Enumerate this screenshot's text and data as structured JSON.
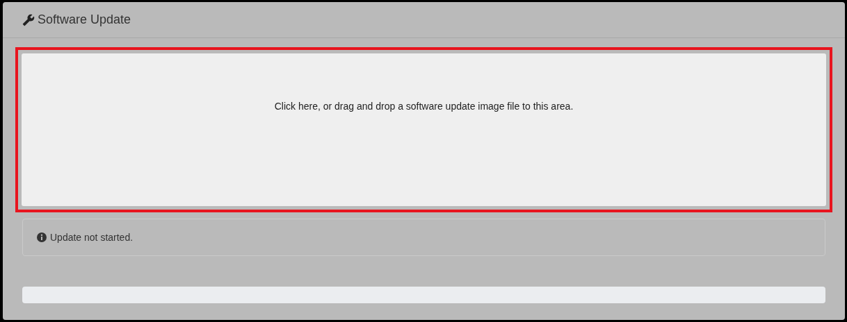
{
  "panel": {
    "title": "Software Update"
  },
  "dropzone": {
    "text": "Click here, or drag and drop a software update image file to this area.",
    "highlighted": true
  },
  "status": {
    "text": "Update not started."
  },
  "progress": {
    "level": 0
  }
}
